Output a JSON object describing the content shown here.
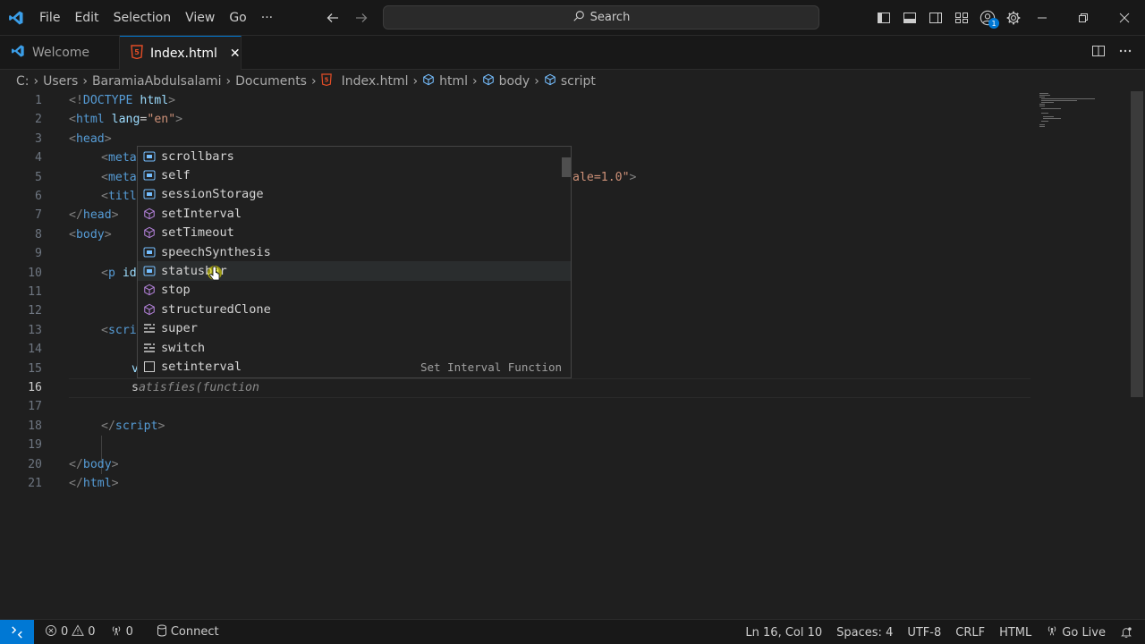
{
  "menu": [
    "File",
    "Edit",
    "Selection",
    "View",
    "Go",
    "···"
  ],
  "search": {
    "label": "Search"
  },
  "title_icons": {
    "account_badge": "1"
  },
  "tabs": [
    {
      "label": "Welcome",
      "icon": "vscode-icon"
    },
    {
      "label": "Index.html",
      "icon": "html-file-icon",
      "close": "✕"
    }
  ],
  "breadcrumb": [
    "C:",
    "Users",
    "BaramiaAbdulsalami",
    "Documents",
    "Index.html",
    "html",
    "body",
    "script"
  ],
  "editor": {
    "current_line": 16,
    "lines": [
      {
        "n": "1"
      },
      {
        "n": "2"
      },
      {
        "n": "3"
      },
      {
        "n": "4"
      },
      {
        "n": "5"
      },
      {
        "n": "6"
      },
      {
        "n": "7"
      },
      {
        "n": "8"
      },
      {
        "n": "9"
      },
      {
        "n": "10"
      },
      {
        "n": "11"
      },
      {
        "n": "12"
      },
      {
        "n": "13"
      },
      {
        "n": "14"
      },
      {
        "n": "15"
      },
      {
        "n": "16"
      },
      {
        "n": "17"
      },
      {
        "n": "18"
      },
      {
        "n": "19"
      },
      {
        "n": "20"
      },
      {
        "n": "21"
      }
    ],
    "code": {
      "l1_a": "<!",
      "l1_b": "DOCTYPE",
      "l1_c": " html",
      "l1_d": ">",
      "l2_a": "<",
      "l2_b": "html",
      "l2_c": " lang",
      "l2_d": "=",
      "l2_e": "\"en\"",
      "l2_f": ">",
      "l3_a": "<",
      "l3_b": "head",
      "l3_c": ">",
      "l4_a": "<",
      "l4_b": "meta",
      "l5_a": "<",
      "l5_b": "meta",
      "l5_tail": "ale=1.0\"",
      "l5_end": ">",
      "l6_a": "<",
      "l6_b": "titl",
      "l7_a": "</",
      "l7_b": "head",
      "l7_c": ">",
      "l8_a": "<",
      "l8_b": "body",
      "l8_c": ">",
      "l10_a": "<",
      "l10_b": "p",
      "l10_c": " id",
      "l13_a": "<",
      "l13_b": "scri",
      "l15_a": "v",
      "l16_a": "s",
      "l16_ghost": "atisfies(function",
      "l18_a": "</",
      "l18_b": "script",
      "l18_c": ">",
      "l20_a": "</",
      "l20_b": "body",
      "l20_c": ">",
      "l21_a": "</",
      "l21_b": "html",
      "l21_c": ">"
    }
  },
  "suggest": {
    "focused_index": 6,
    "items": [
      {
        "label": "scrollbars",
        "kind": "variable"
      },
      {
        "label": "self",
        "kind": "variable"
      },
      {
        "label": "sessionStorage",
        "kind": "variable"
      },
      {
        "label": "setInterval",
        "kind": "method"
      },
      {
        "label": "setTimeout",
        "kind": "method"
      },
      {
        "label": "speechSynthesis",
        "kind": "variable"
      },
      {
        "label": "statusbar",
        "kind": "variable"
      },
      {
        "label": "stop",
        "kind": "method"
      },
      {
        "label": "structuredClone",
        "kind": "method"
      },
      {
        "label": "super",
        "kind": "keyword"
      },
      {
        "label": "switch",
        "kind": "keyword"
      },
      {
        "label": "setinterval",
        "kind": "snippet",
        "detail": "Set Interval Function"
      }
    ]
  },
  "status": {
    "errors": "0",
    "warnings": "0",
    "ports": "0",
    "connect": "Connect",
    "position": "Ln 16, Col 10",
    "spaces": "Spaces: 4",
    "encoding": "UTF-8",
    "eol": "CRLF",
    "language": "HTML",
    "golive": "Go Live"
  },
  "colors": {
    "accent": "#0078d4",
    "tag": "#569cd6",
    "attr": "#9cdcfe",
    "string": "#ce9178",
    "html_icon": "#e44d26"
  }
}
